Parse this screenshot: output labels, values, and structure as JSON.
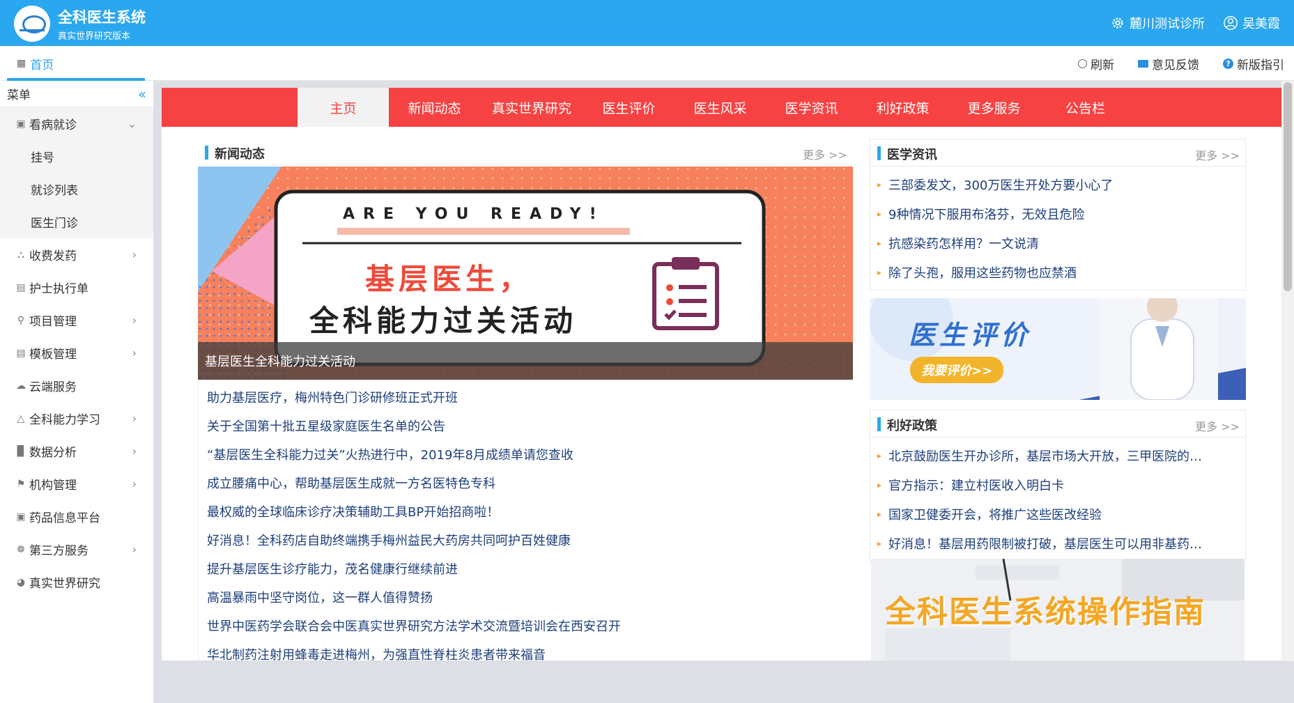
{
  "header": {
    "app_title": "全科医生系统",
    "app_subtitle": "真实世界研究版本",
    "clinic_name": "麓川测试诊所",
    "user_name": "吴美霞"
  },
  "tabbar": {
    "home_label": "首页",
    "refresh_label": "刷新",
    "feedback_label": "意见反馈",
    "guide_label": "新版指引"
  },
  "sidebar": {
    "menu_title": "菜单",
    "items": [
      {
        "label": "看病就诊",
        "icon": "medical-kit-icon"
      },
      {
        "label": "挂号"
      },
      {
        "label": "就诊列表"
      },
      {
        "label": "医生门诊"
      },
      {
        "label": "收费发药",
        "icon": "cart-icon"
      },
      {
        "label": "护士执行单",
        "icon": "document-icon"
      },
      {
        "label": "项目管理",
        "icon": "user-search-icon"
      },
      {
        "label": "模板管理",
        "icon": "template-icon"
      },
      {
        "label": "云端服务",
        "icon": "cloud-icon"
      },
      {
        "label": "全科能力学习",
        "icon": "people-icon"
      },
      {
        "label": "数据分析",
        "icon": "bar-chart-icon"
      },
      {
        "label": "机构管理",
        "icon": "flag-icon"
      },
      {
        "label": "药品信息平台",
        "icon": "pill-box-icon"
      },
      {
        "label": "第三方服务",
        "icon": "settings-icon"
      },
      {
        "label": "真实世界研究",
        "icon": "globe-icon"
      }
    ]
  },
  "rednav": {
    "items": [
      "主页",
      "新闻动态",
      "真实世界研究",
      "医生评价",
      "医生风采",
      "医学资讯",
      "利好政策",
      "更多服务",
      "公告栏"
    ]
  },
  "news": {
    "title": "新闻动态",
    "more": "更多 >>",
    "banner_top_text": "ARE YOU READY!",
    "banner_line1": "基层医生，",
    "banner_line2": "全科能力过关活动",
    "banner_caption": "基层医生全科能力过关活动",
    "items": [
      "助力基层医疗，梅州特色门诊研修班正式开班",
      "关于全国第十批五星级家庭医生名单的公告",
      "“基层医生全科能力过关”火热进行中，2019年8月成绩单请您查收",
      "成立腰痛中心，帮助基层医生成就一方名医特色专科",
      "最权威的全球临床诊疗决策辅助工具BP开始招商啦！",
      "好消息！全科药店自助终端携手梅州益民大药房共同呵护百姓健康",
      "提升基层医生诊疗能力，茂名健康行继续前进",
      "高温暴雨中坚守岗位，这一群人值得赞扬",
      "世界中医药学会联合会中医真实世界研究方法学术交流暨培训会在西安召开",
      "华北制药注射用蜂毒走进梅州，为强直性脊柱炎患者带来福音"
    ]
  },
  "medinfo": {
    "title": "医学资讯",
    "more": "更多 >>",
    "items": [
      "三部委发文，300万医生开处方要小心了",
      "9种情况下服用布洛芬，无效且危险",
      "抗感染药怎样用？一文说清",
      "除了头孢，服用这些药物也应禁酒"
    ]
  },
  "eval_banner": {
    "title": "医生评价",
    "button": "我要评价>>"
  },
  "policy": {
    "title": "利好政策",
    "more": "更多 >>",
    "items": [
      "北京鼓励医生开办诊所，基层市场大开放，三甲医院的…",
      "官方指示：建立村医收入明白卡",
      "国家卫健委开会，将推广这些医改经验",
      "好消息！基层用药限制被打破，基层医生可以用非基药…"
    ]
  },
  "guide_banner": {
    "title": "全科医生系统操作指南"
  },
  "colors": {
    "header_blue": "#2aa7ee",
    "nav_red": "#f64242",
    "link_navy": "#1e3f7a"
  }
}
